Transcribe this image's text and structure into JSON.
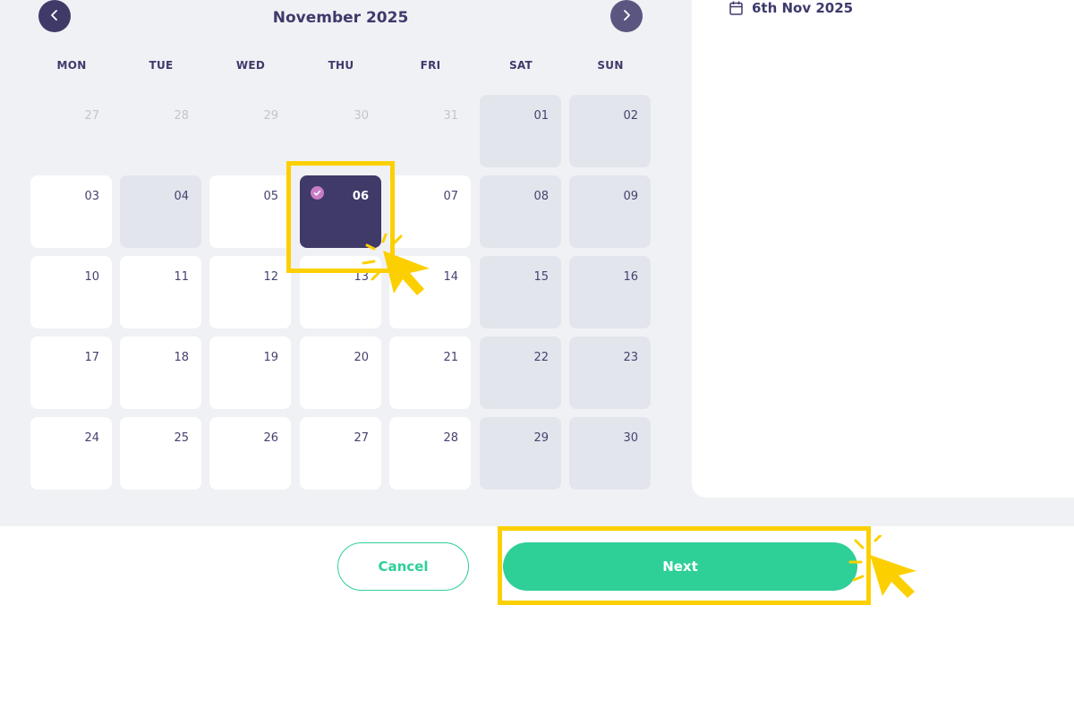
{
  "calendar": {
    "month_title": "November 2025",
    "weekdays": [
      "MON",
      "TUE",
      "WED",
      "THU",
      "FRI",
      "SAT",
      "SUN"
    ],
    "weeks": [
      [
        {
          "d": "27",
          "state": "outside"
        },
        {
          "d": "28",
          "state": "outside"
        },
        {
          "d": "29",
          "state": "outside"
        },
        {
          "d": "30",
          "state": "outside"
        },
        {
          "d": "31",
          "state": "outside"
        },
        {
          "d": "01",
          "state": "unavailable"
        },
        {
          "d": "02",
          "state": "unavailable"
        }
      ],
      [
        {
          "d": "03",
          "state": "available"
        },
        {
          "d": "04",
          "state": "unavailable"
        },
        {
          "d": "05",
          "state": "available"
        },
        {
          "d": "06",
          "state": "selected"
        },
        {
          "d": "07",
          "state": "available"
        },
        {
          "d": "08",
          "state": "unavailable"
        },
        {
          "d": "09",
          "state": "unavailable"
        }
      ],
      [
        {
          "d": "10",
          "state": "available"
        },
        {
          "d": "11",
          "state": "available"
        },
        {
          "d": "12",
          "state": "available"
        },
        {
          "d": "13",
          "state": "available"
        },
        {
          "d": "14",
          "state": "available"
        },
        {
          "d": "15",
          "state": "unavailable"
        },
        {
          "d": "16",
          "state": "unavailable"
        }
      ],
      [
        {
          "d": "17",
          "state": "available"
        },
        {
          "d": "18",
          "state": "available"
        },
        {
          "d": "19",
          "state": "available"
        },
        {
          "d": "20",
          "state": "available"
        },
        {
          "d": "21",
          "state": "available"
        },
        {
          "d": "22",
          "state": "unavailable"
        },
        {
          "d": "23",
          "state": "unavailable"
        }
      ],
      [
        {
          "d": "24",
          "state": "available"
        },
        {
          "d": "25",
          "state": "available"
        },
        {
          "d": "26",
          "state": "available"
        },
        {
          "d": "27",
          "state": "available"
        },
        {
          "d": "28",
          "state": "available"
        },
        {
          "d": "29",
          "state": "unavailable"
        },
        {
          "d": "30",
          "state": "unavailable"
        }
      ]
    ],
    "prev_icon": "chevron-left-icon",
    "next_icon": "chevron-right-icon",
    "selected_check_icon": "check-circle-icon"
  },
  "summary": {
    "icon": "calendar-icon",
    "date_text": "6th Nov 2025"
  },
  "actions": {
    "cancel_label": "Cancel",
    "next_label": "Next"
  },
  "colors": {
    "primary": "#3f3a68",
    "accent": "#2fcf98",
    "highlight": "#fcd000",
    "unavailable": "#e2e5ec",
    "check": "#c77dc4"
  }
}
